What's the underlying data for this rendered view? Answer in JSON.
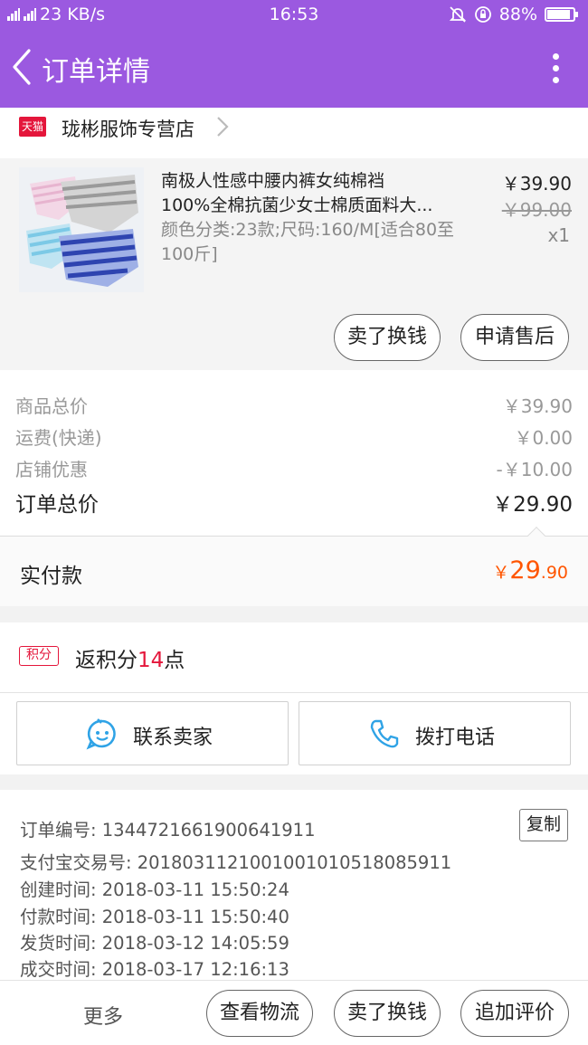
{
  "status_bar": {
    "network": "2G 4G 4G",
    "speed": "23 KB/s",
    "time": "16:53",
    "battery": "88%",
    "battery_level": 0.88
  },
  "header": {
    "title": "订单详情"
  },
  "shop": {
    "badge": "天猫",
    "name": "珑彬服饰专营店"
  },
  "product": {
    "title_line1": "南极人性感中腰内裤女纯棉裆",
    "title_line2": "100%全棉抗菌少女士棉质面料大...",
    "sku": "颜色分类:23款;尺码:160/M[适合80至100斤]",
    "price": "￥39.90",
    "original_price": "￥99.00",
    "quantity": "x1",
    "actions": [
      "卖了换钱",
      "申请售后"
    ]
  },
  "summary": [
    {
      "label": "商品总价",
      "value": "￥39.90"
    },
    {
      "label": "运费(快递)",
      "value": "￥0.00"
    },
    {
      "label": "店铺优惠",
      "value": "-￥10.00"
    },
    {
      "label": "订单总价",
      "value": "￥29.90"
    }
  ],
  "paid": {
    "label": "实付款",
    "currency": "￥",
    "integer": "29",
    "decimal": ".90"
  },
  "points": {
    "badge": "积分",
    "prefix": "返积分",
    "count": "14",
    "suffix": "点"
  },
  "contact": {
    "seller": "联系卖家",
    "phone": "拨打电话"
  },
  "order_info": {
    "order_no": "订单编号: 1344721661900641911",
    "copy_label": "复制",
    "alipay_no": "支付宝交易号: 2018031121001001010518085911",
    "created": "创建时间: 2018-03-11 15:50:24",
    "paid": "付款时间: 2018-03-11 15:50:40",
    "shipped": "发货时间: 2018-03-12 14:05:59",
    "completed": "成交时间: 2018-03-17 12:16:13"
  },
  "bottom_bar": {
    "more": "更多",
    "logistics": "查看物流",
    "sell": "卖了换钱",
    "review": "追加评价"
  },
  "colors": {
    "header_purple": "#9b59e0",
    "price_orange": "#ff5500",
    "tmall_red": "#e4163b",
    "contact_blue": "#2fa3e6"
  }
}
